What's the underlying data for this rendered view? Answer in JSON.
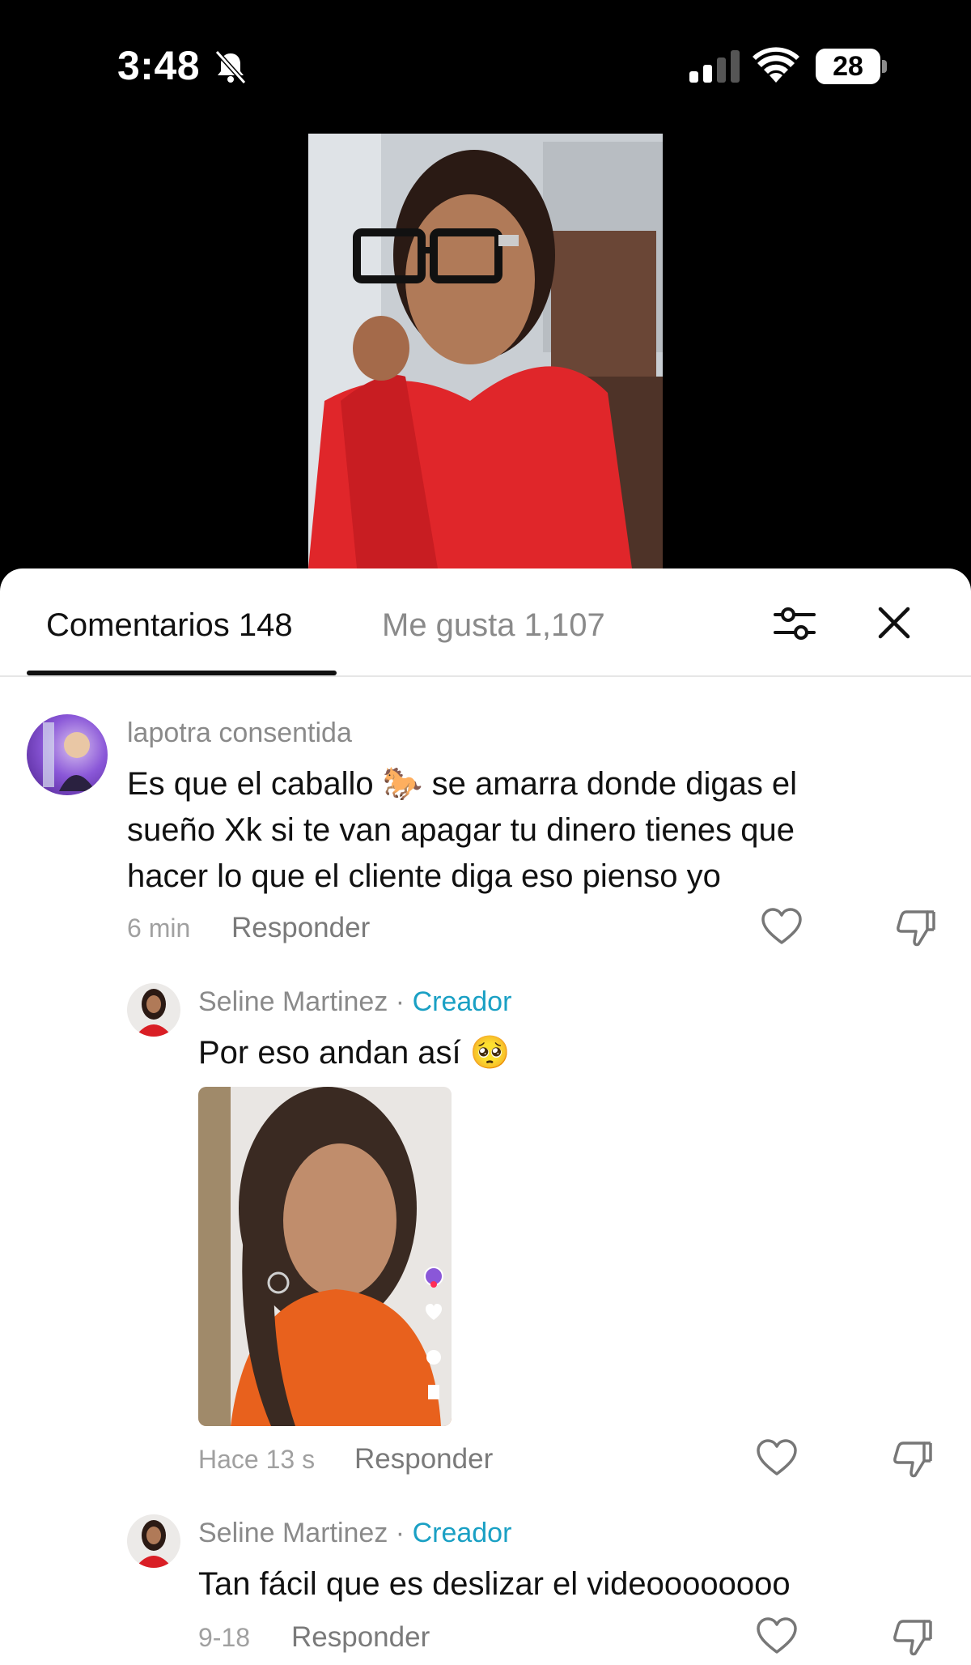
{
  "status_bar": {
    "time": "3:48",
    "battery": "28"
  },
  "tabs": {
    "comments_label": "Comentarios 148",
    "likes_label": "Me gusta 1,107"
  },
  "comments": [
    {
      "username": "lapotra consentida",
      "text_line1": "Es que el caballo 🐎 se amarra donde digas el",
      "text_line2": "sueño Xk si te van apagar tu dinero tienes que",
      "text_line3": "hacer lo que el cliente diga eso pienso yo",
      "time": "6 min",
      "reply_label": "Responder"
    },
    {
      "username": "Seline Martinez",
      "separator": " · ",
      "badge": "Creador",
      "text": "Por eso andan así 🥺",
      "time": "Hace 13 s",
      "reply_label": "Responder"
    },
    {
      "username": "Seline Martinez",
      "separator": " · ",
      "badge": "Creador",
      "text": "Tan fácil que es deslizar el videoooooooo",
      "time": "9-18",
      "reply_label": "Responder"
    }
  ],
  "colors": {
    "accent_creator": "#1aa0c4",
    "tab_active": "#111111",
    "tab_inactive": "#8a8a8a"
  },
  "icons": {
    "bell": "bell-slash-icon",
    "filter": "sliders-icon",
    "close": "close-icon",
    "like": "heart-icon",
    "dislike": "thumbs-down-icon"
  }
}
